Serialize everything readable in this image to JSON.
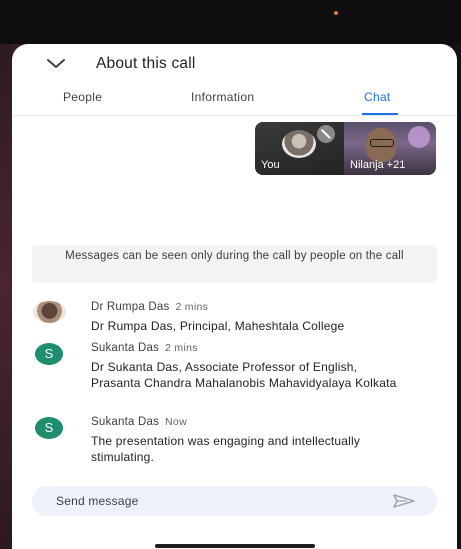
{
  "header": {
    "title": "About this call"
  },
  "tabs": [
    {
      "label": "People"
    },
    {
      "label": "Information"
    },
    {
      "label": "Chat"
    }
  ],
  "active_tab": "Chat",
  "tiles": {
    "self_label": "You",
    "other_label": "Nilanja +21"
  },
  "notice": "Messages can be seen only during the call by people on the call",
  "messages": [
    {
      "sender": "Dr Rumpa Das",
      "time": "2 mins",
      "text": "Dr Rumpa Das, Principal, Maheshtala College"
    },
    {
      "sender": "Sukanta Das",
      "initial": "S",
      "time": "2 mins",
      "text": "Dr Sukanta Das, Associate Professor of English, Prasanta Chandra Mahalanobis Mahavidyalaya Kolkata"
    },
    {
      "sender": "Sukanta Das",
      "initial": "S",
      "time": "Now",
      "text": "The presentation was engaging and intellectually stimulating."
    }
  ],
  "composer": {
    "placeholder": "Send message"
  },
  "colors": {
    "accent": "#1a73e8",
    "avatar_green": "#1e8e6e",
    "composer_bg": "#eef1fa"
  }
}
